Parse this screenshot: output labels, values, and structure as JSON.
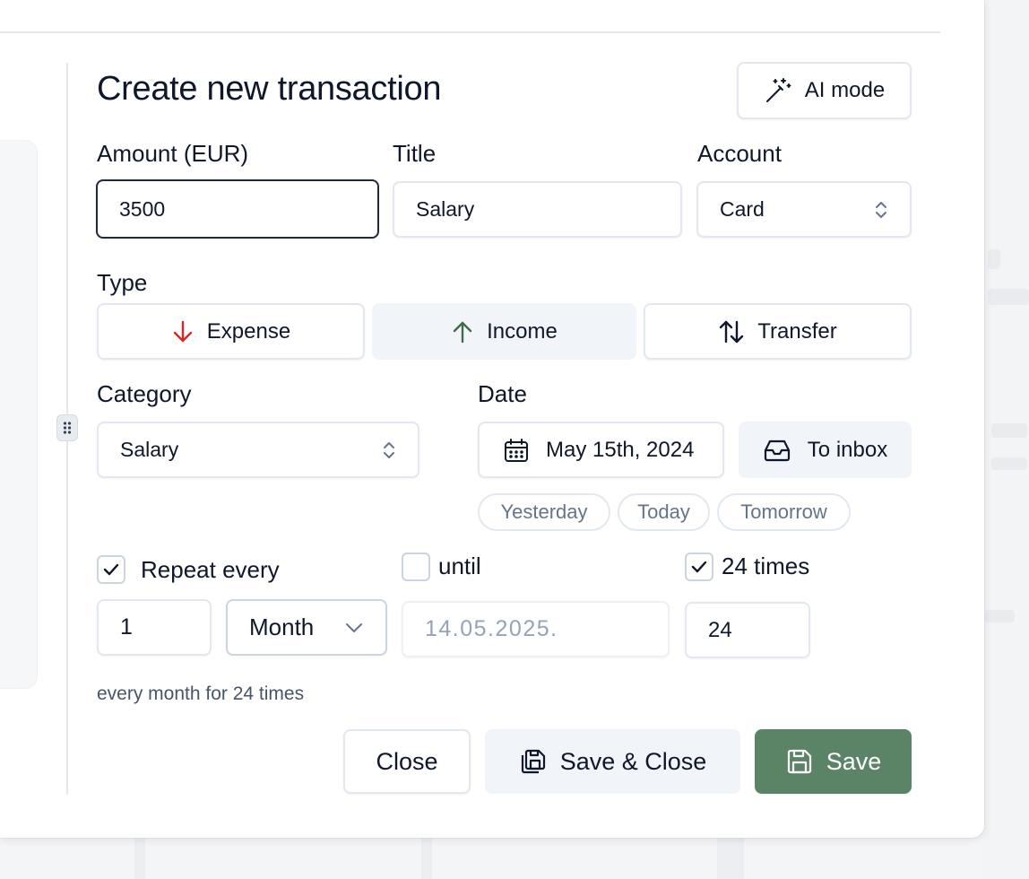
{
  "form": {
    "title": "Create new transaction",
    "ai_mode_label": "AI mode",
    "amount": {
      "label": "Amount (EUR)",
      "value": "3500"
    },
    "title_field": {
      "label": "Title",
      "value": "Salary"
    },
    "account": {
      "label": "Account",
      "value": "Card"
    },
    "type": {
      "label": "Type",
      "options": [
        {
          "label": "Expense",
          "icon": "arrow-down-icon",
          "color": "#dc2626"
        },
        {
          "label": "Income",
          "icon": "arrow-up-icon",
          "color": "#3f6b4a",
          "selected": true
        },
        {
          "label": "Transfer",
          "icon": "arrows-up-down-icon"
        }
      ]
    },
    "category": {
      "label": "Category",
      "value": "Salary"
    },
    "date": {
      "label": "Date",
      "value": "May 15th, 2024",
      "to_inbox_label": "To inbox",
      "quick": [
        "Yesterday",
        "Today",
        "Tomorrow"
      ]
    },
    "repeat": {
      "repeat_label": "Repeat every",
      "repeat_checked": true,
      "interval": "1",
      "unit": "Month",
      "until_label": "until",
      "until_checked": false,
      "until_placeholder": "14.05.2025.",
      "times_label": "24 times",
      "times_checked": true,
      "times_value": "24",
      "summary": "every month for 24 times"
    },
    "actions": {
      "close": "Close",
      "save_close": "Save & Close",
      "save": "Save"
    }
  },
  "colors": {
    "primary": "#5b8466",
    "expense": "#dc2626",
    "income": "#3f6b4a",
    "muted_bg": "#f1f5f9"
  }
}
